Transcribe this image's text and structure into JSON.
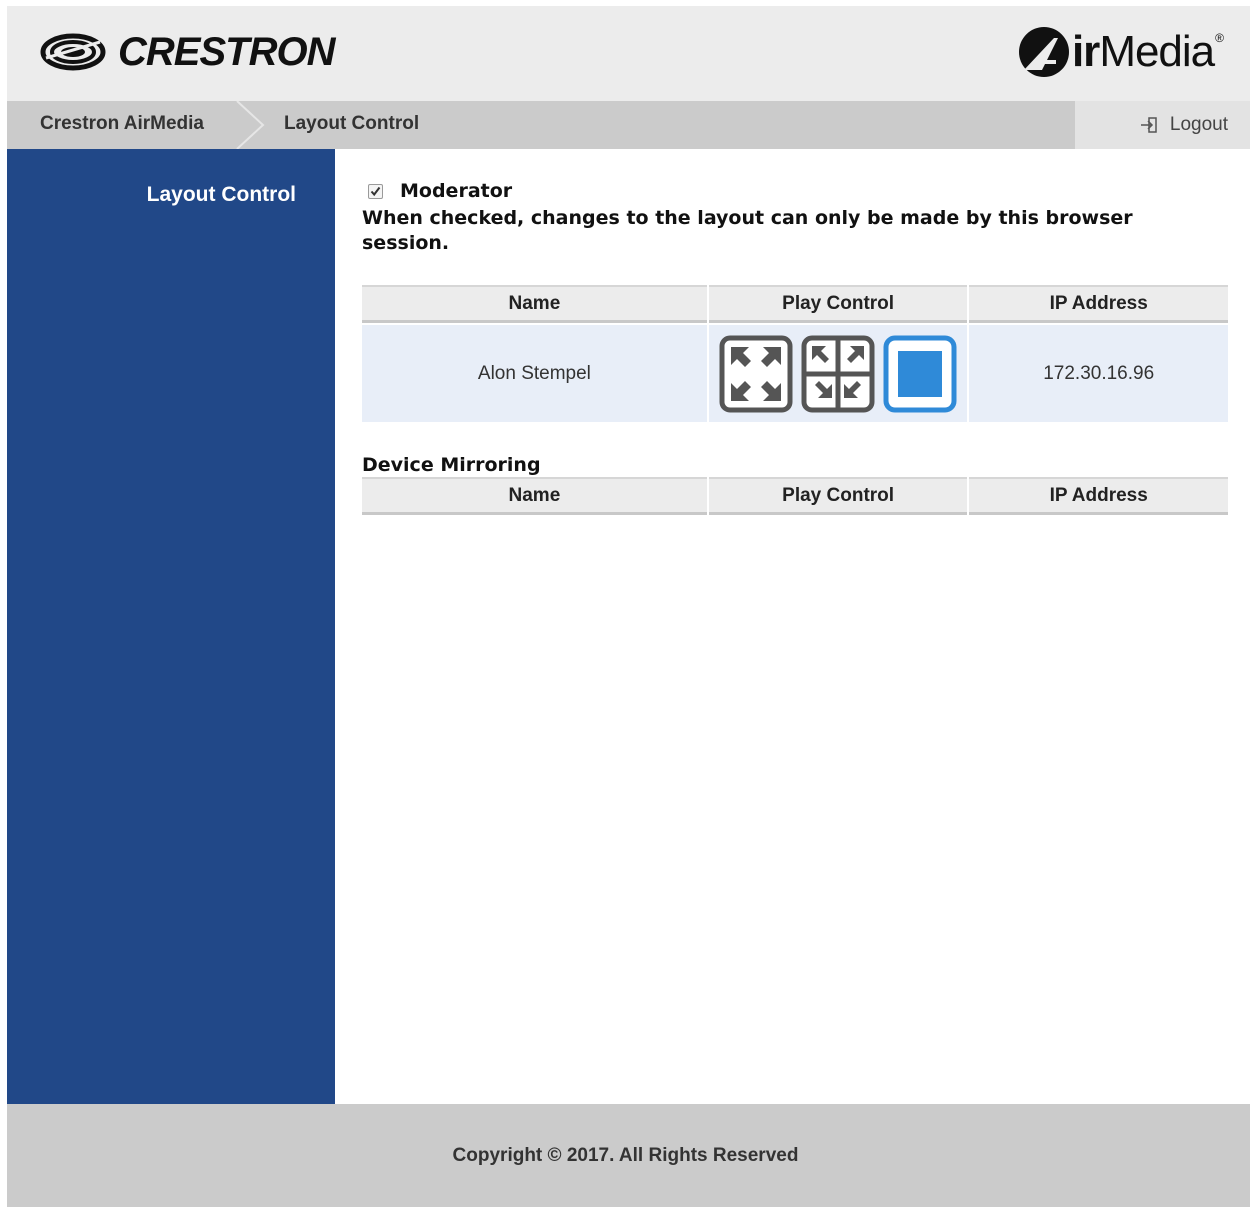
{
  "header": {
    "brand": "CRESTRON",
    "product_bold": "ir",
    "product_regular": "Media",
    "product_mark": "®"
  },
  "breadcrumb": {
    "items": [
      {
        "label": "Crestron AirMedia"
      },
      {
        "label": "Layout Control"
      }
    ]
  },
  "logout": {
    "label": "Logout"
  },
  "sidebar": {
    "items": [
      {
        "label": "Layout Control",
        "active": true
      }
    ]
  },
  "moderator": {
    "label": "Moderator",
    "checked": true,
    "description": "When checked, changes to the layout can only be made by this browser session."
  },
  "users_table": {
    "columns": [
      "Name",
      "Play Control",
      "IP Address"
    ],
    "rows": [
      {
        "name": "Alon Stempel",
        "ip": "172.30.16.96",
        "controls": [
          "fullscreen-icon",
          "quad-layout-icon",
          "stop-icon"
        ]
      }
    ]
  },
  "device_mirroring": {
    "title": "Device Mirroring",
    "columns": [
      "Name",
      "Play Control",
      "IP Address"
    ],
    "rows": []
  },
  "footer": {
    "copyright": "Copyright © 2017. All Rights Reserved"
  },
  "colors": {
    "sidebar": "#214888",
    "header": "#ececec",
    "bar": "#cbcbcb",
    "row": "#e8eef8",
    "stop_blue": "#2f8ad8",
    "icon_gray": "#555555"
  }
}
